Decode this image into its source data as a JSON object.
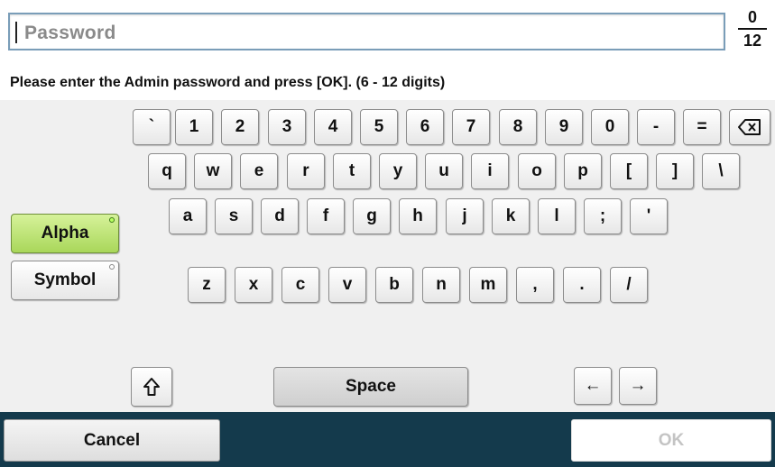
{
  "password_field": {
    "placeholder": "Password"
  },
  "counter": {
    "current": "0",
    "max": "12"
  },
  "instruction": "Please enter the Admin password and press [OK]. (6 - 12 digits)",
  "keyboard": {
    "row1": [
      "`",
      "1",
      "2",
      "3",
      "4",
      "5",
      "6",
      "7",
      "8",
      "9",
      "0",
      "-",
      "="
    ],
    "row2": [
      "q",
      "w",
      "e",
      "r",
      "t",
      "y",
      "u",
      "i",
      "o",
      "p",
      "[",
      "]",
      "\\"
    ],
    "row3": [
      "a",
      "s",
      "d",
      "f",
      "g",
      "h",
      "j",
      "k",
      "l",
      ";",
      "'"
    ],
    "row4": [
      "z",
      "x",
      "c",
      "v",
      "b",
      "n",
      "m",
      ",",
      ".",
      "/"
    ],
    "mode_alpha": "Alpha",
    "mode_symbol": "Symbol",
    "space_label": "Space",
    "backspace_icon": "backspace-icon",
    "shift_icon": "shift-arrow-icon",
    "left_arrow": "←",
    "right_arrow": "→"
  },
  "footer": {
    "cancel_label": "Cancel",
    "ok_label": "OK"
  },
  "colors": {
    "accent_green": "#a9d75a",
    "footer_bg": "#143a4c",
    "field_border": "#7a9db8"
  }
}
